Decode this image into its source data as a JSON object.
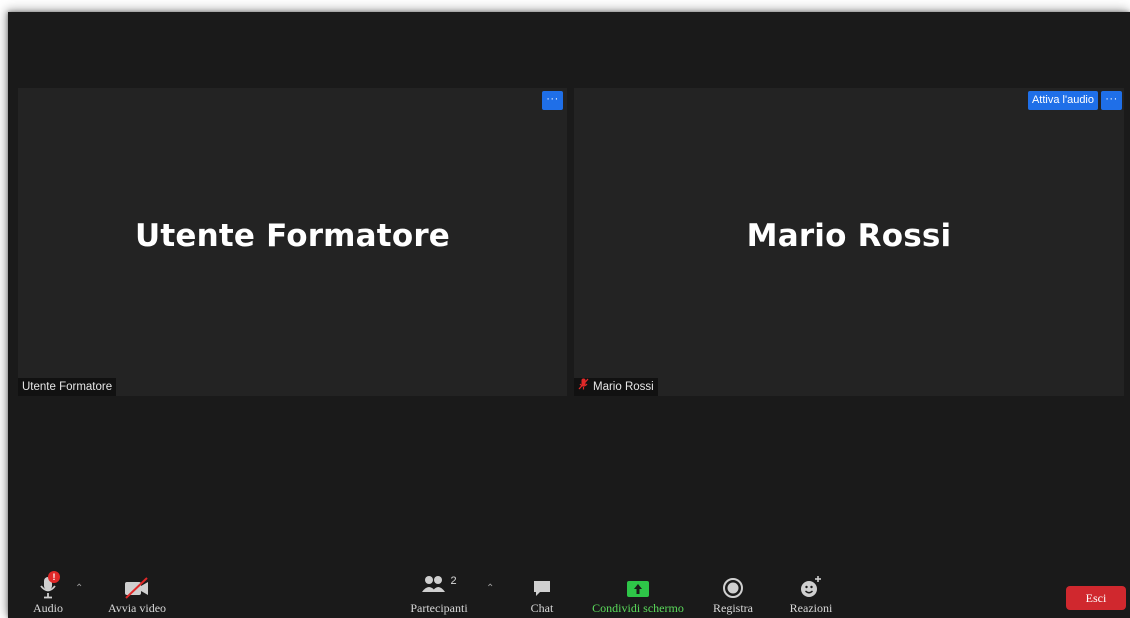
{
  "tiles": [
    {
      "display_name": "Utente Formatore",
      "label": "Utente Formatore",
      "more": "···"
    },
    {
      "display_name": "Mario Rossi",
      "label": "Mario Rossi",
      "more": "···",
      "unmute": "Attiva l'audio"
    }
  ],
  "toolbar": {
    "audio": "Audio",
    "video": "Avvia video",
    "participants": "Partecipanti",
    "participant_count": "2",
    "chat": "Chat",
    "share": "Condividi schermo",
    "record": "Registra",
    "reactions": "Reazioni",
    "leave": "Esci",
    "audio_alert": "!"
  },
  "colors": {
    "accent_blue": "#1f6fe8",
    "share_green": "#5bdb5b",
    "leave_red": "#d0282e",
    "muted_red": "#e02828"
  }
}
